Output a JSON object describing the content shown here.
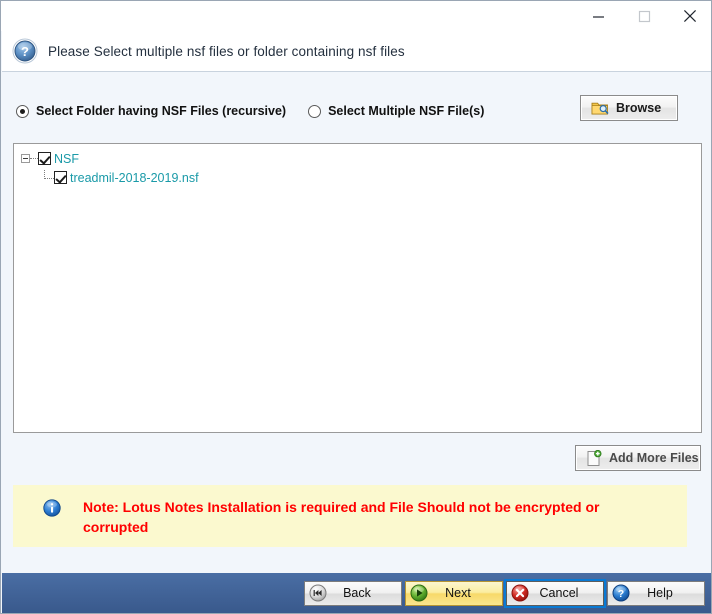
{
  "window": {
    "title": "",
    "controls": {
      "minimize": "minimize",
      "maximize": "maximize",
      "close": "close"
    }
  },
  "header": {
    "icon": "question-mark-icon",
    "text": "Please Select multiple nsf files or folder containing nsf files"
  },
  "source_options": {
    "folder": {
      "label": "Select Folder having NSF Files (recursive)",
      "selected": true
    },
    "files": {
      "label": "Select Multiple NSF File(s)",
      "selected": false
    }
  },
  "browse": {
    "label": "Browse",
    "icon": "folder-search-icon"
  },
  "tree": {
    "root": {
      "label": "NSF",
      "checked": true,
      "expanded": true
    },
    "children": [
      {
        "label": "treadmil-2018-2019.nsf",
        "checked": true
      }
    ]
  },
  "add_more": {
    "label": "Add More Files",
    "icon": "file-add-icon",
    "enabled": false
  },
  "note": {
    "icon": "info-icon",
    "text": "Note: Lotus Notes Installation is required and File Should not be encrypted or corrupted"
  },
  "actions": {
    "back": {
      "label": "Back",
      "icon": "rewind-icon"
    },
    "next": {
      "label": "Next",
      "icon": "play-icon"
    },
    "cancel": {
      "label": "Cancel",
      "icon": "close-circle-icon"
    },
    "help": {
      "label": "Help",
      "icon": "question-circle-icon"
    }
  },
  "colors": {
    "accent_blue": "#3d6399",
    "tree_text": "#1a9aa8",
    "note_bg": "#fbf9cf",
    "note_text": "#ff0000",
    "next_gold": "#f7d969",
    "panel_bg": "#f2f6fb"
  }
}
